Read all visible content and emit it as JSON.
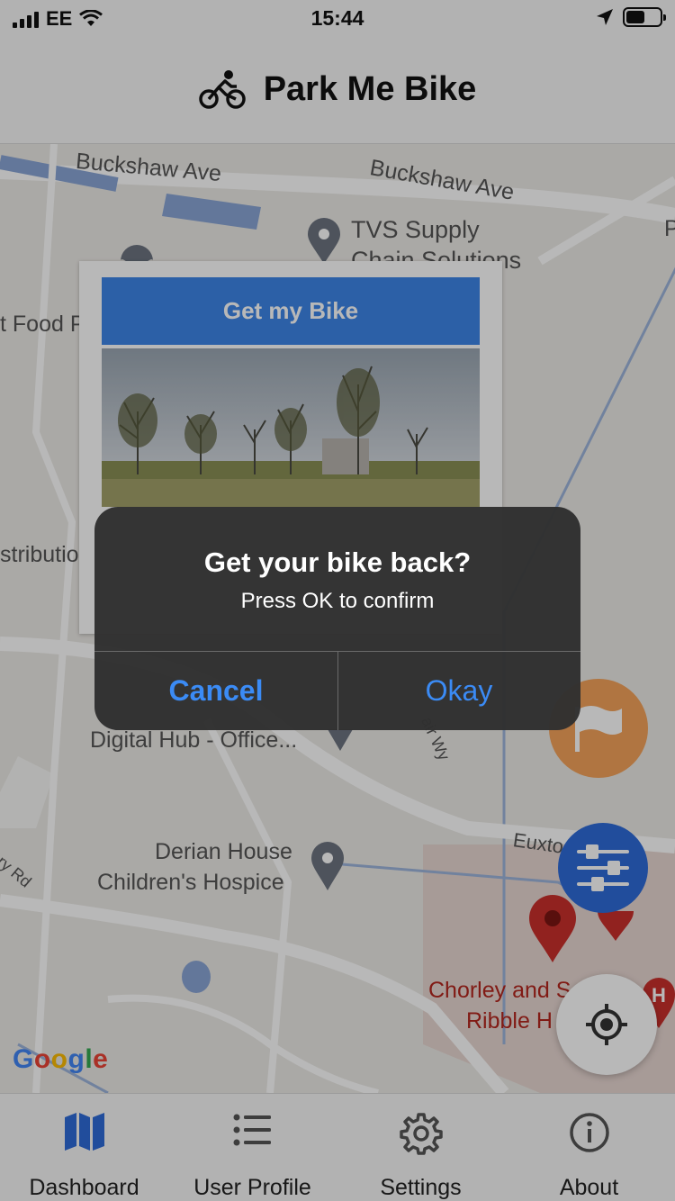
{
  "status_bar": {
    "carrier": "EE",
    "time": "15:44"
  },
  "header": {
    "title": "Park Me Bike",
    "icon": "bicycle-rider-icon"
  },
  "map": {
    "labels": {
      "road_1": "Buckshaw Ave",
      "road_2": "Buckshaw Ave",
      "poi_tvs": "TVS Supply",
      "poi_tvs_line2": "Chain Solutions",
      "poi_food": "t Food P",
      "poi_distribution": "stributio",
      "poi_digital": "Digital Hub - Office...",
      "road_fair": "air Wy",
      "road_euxton": "Euxto",
      "poi_derian_1": "Derian House",
      "poi_derian_2": "Children's Hospice",
      "road_ry": "ry Rd",
      "hospital_1": "Chorley and S",
      "hospital_2": "Ribble H",
      "edge_p": "P"
    },
    "google_logo": "Google"
  },
  "info_card": {
    "button_label": "Get my Bike"
  },
  "alert": {
    "title": "Get your bike back?",
    "message": "Press OK to confirm",
    "cancel_label": "Cancel",
    "ok_label": "Okay",
    "button_color": "#3b8bf5"
  },
  "fabs": {
    "flag": "flag-icon",
    "filter": "sliders-icon",
    "locate": "crosshair-icon"
  },
  "tabs": [
    {
      "label": "Dashboard",
      "icon": "map-icon",
      "active": true
    },
    {
      "label": "User Profile",
      "icon": "list-icon",
      "active": false
    },
    {
      "label": "Settings",
      "icon": "gear-icon",
      "active": false
    },
    {
      "label": "About",
      "icon": "info-icon",
      "active": false
    }
  ],
  "colors": {
    "accent": "#2f6bd8",
    "flag_button": "#f4a25a",
    "get_bike_button": "#3d86e8"
  }
}
